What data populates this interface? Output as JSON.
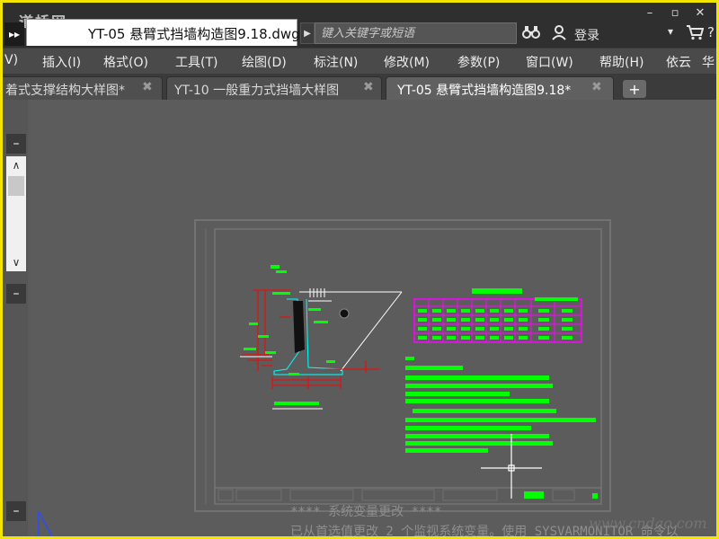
{
  "watermark_top_left": "道桥网",
  "app_button_glyph": "▸▸",
  "file_tab": {
    "title": "YT-05 悬臂式挡墙构造图9.18.dwg"
  },
  "search": {
    "placeholder": "键入关键字或短语"
  },
  "titlebar": {
    "binoculars_glyph": "⌖",
    "user_glyph": "☺",
    "login_label": "登录",
    "dropdown_glyph": "▾",
    "cart_glyph": "⛟",
    "help_glyph": "?",
    "minimize_glyph": "–",
    "restore_glyph": "▫",
    "close_glyph": "✕"
  },
  "menu": [
    "V)",
    "插入(I)",
    "格式(O)",
    "工具(T)",
    "绘图(D)",
    "标注(N)",
    "修改(M)",
    "参数(P)",
    "窗口(W)",
    "帮助(H)",
    "依云",
    "华"
  ],
  "doc_tabs": [
    {
      "label": "着式支撑结构大样图*",
      "close": "✖",
      "active": false
    },
    {
      "label": "YT-10 一般重力式挡墙大样图",
      "close": "✖",
      "active": false
    },
    {
      "label": "YT-05 悬臂式挡墙构造图9.18*",
      "close": "✖",
      "active": true
    }
  ],
  "new_tab_glyph": "+",
  "left_panel": {
    "collapse_glyph": "–",
    "scroll_up_glyph": "∧",
    "scroll_down_glyph": "∨"
  },
  "command_line": {
    "line1": "**** 系统变量更改 ****",
    "line2": "已从首选值更改 2 个监视系统变量。使用 SYSVARMONITOR 命令以"
  },
  "watermark_bottom_right": "www.cndao.com",
  "colors": {
    "highlight_border": "#f2e600",
    "cad_green": "#00ff00",
    "cad_red": "#ff0000",
    "cad_magenta": "#ff00ff",
    "cad_cyan": "#00ffff",
    "canvas_bg": "#5c5c5c"
  },
  "icons": {
    "app": "app-menu-icon",
    "search_arrow": "chevron-right-icon",
    "binoculars": "binoculars-icon",
    "user": "user-icon",
    "cart": "cart-icon",
    "help": "help-icon",
    "crosshair": "crosshair-cursor-icon",
    "ucs": "ucs-icon"
  }
}
